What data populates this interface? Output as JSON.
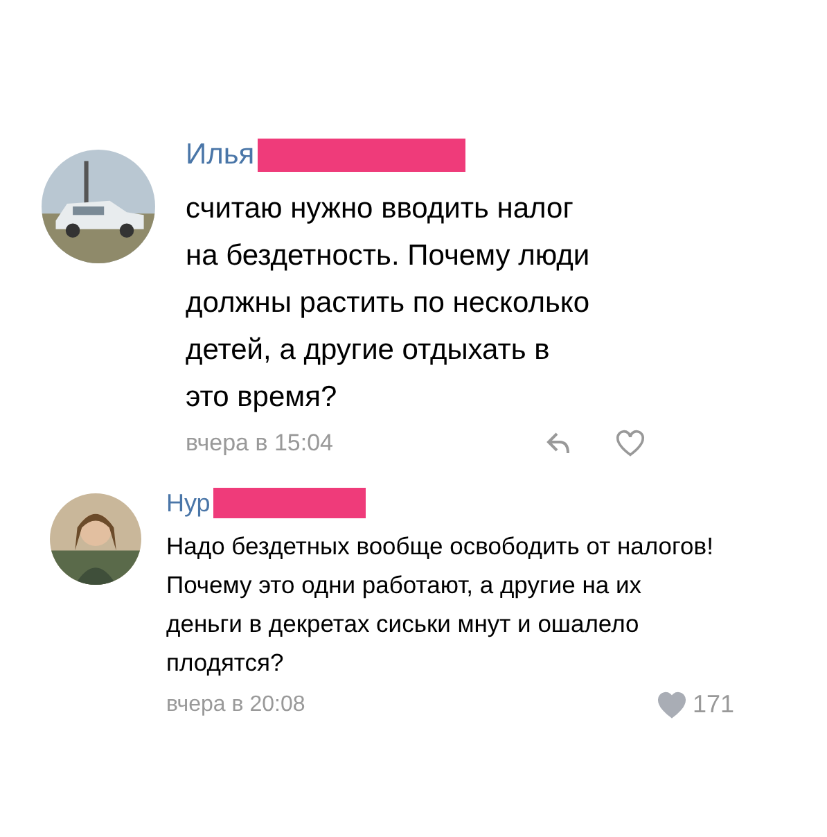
{
  "comments": [
    {
      "author": "Илья",
      "text": "считаю нужно вводить налог на бездетность. Почему люди должны растить по несколько детей, а другие отдыхать в это время?",
      "time": "вчера в 15:04",
      "liked": false,
      "show_reply": true
    },
    {
      "author": "Нур",
      "text": "Надо бездетных вообще освободить от налогов! Почему это одни работают, а другие на их деньги в декретах сиськи мнут и ошалело плодятся?",
      "time": "вчера в 20:08",
      "liked": true,
      "likes": "171",
      "show_reply": false
    }
  ]
}
